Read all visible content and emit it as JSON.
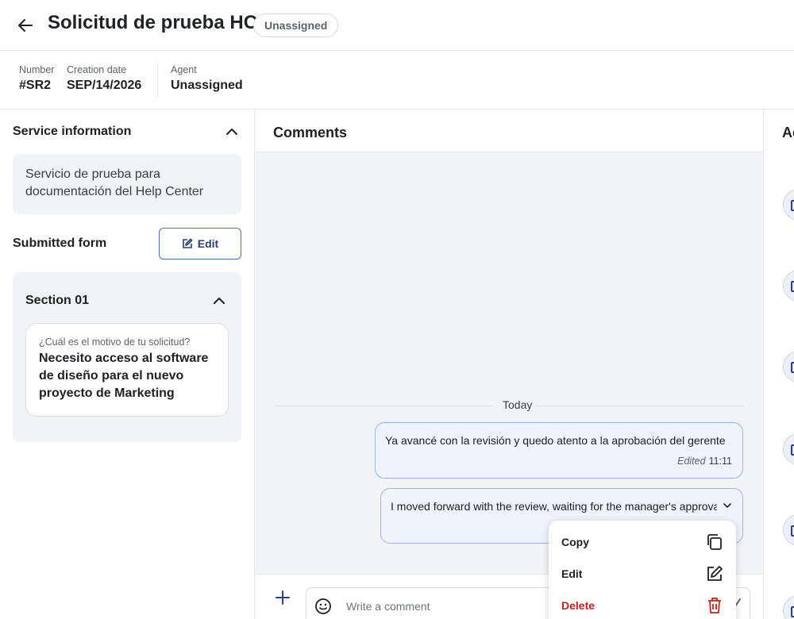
{
  "header": {
    "title": "Solicitud de prueba HC",
    "status": "Unassigned"
  },
  "meta": {
    "number_label": "Number",
    "number_value": "#SR2",
    "creation_label": "Creation date",
    "creation_value": "SEP/14/2026",
    "agent_label": "Agent",
    "agent_value": "Unassigned"
  },
  "left_panel": {
    "service_info_title": "Service information",
    "service_description": "Servicio de prueba para documentación del Help Center",
    "submitted_form_title": "Submitted form",
    "edit_label": "Edit",
    "section": {
      "title": "Section 01",
      "question": "¿Cuál es el motivo de tu solicitud?",
      "answer": "Necesito acceso al software de diseño para el nuevo proyecto de Marketing"
    }
  },
  "comments": {
    "title": "Comments",
    "day_separator": "Today",
    "messages": [
      {
        "text": "Ya avancé con la revisión y quedo atento a la aprobación del gerente",
        "edited_label": "Edited",
        "time": "11:11"
      },
      {
        "text": "I moved forward with the review, waiting for the manager's approval"
      }
    ],
    "composer_placeholder": "Write a comment"
  },
  "context_menu": {
    "items": [
      {
        "label": "Copy",
        "icon": "copy-icon"
      },
      {
        "label": "Edit",
        "icon": "edit-icon"
      },
      {
        "label": "Delete",
        "icon": "trash-icon",
        "color": "#c5221f"
      }
    ]
  },
  "right_panel": {
    "title_partial": "Ac"
  },
  "colors": {
    "accent": "#2d3e9e",
    "bubble_bg": "#eef3fd",
    "bubble_border": "#9fb6e3",
    "danger": "#c5221f",
    "panel_bg": "#f3f4f6"
  }
}
